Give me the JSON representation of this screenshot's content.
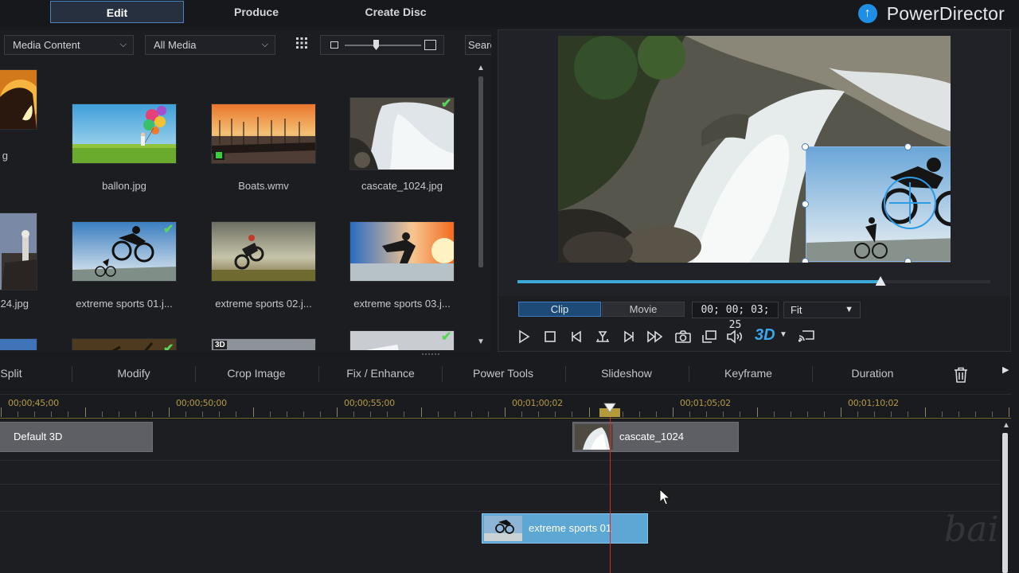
{
  "top_tabs": {
    "edit": "Edit",
    "produce": "Produce",
    "create_disc": "Create Disc"
  },
  "brand": {
    "name": "PowerDirector",
    "logo_glyph": "↑"
  },
  "library": {
    "content_dropdown": "Media Content",
    "filter_dropdown": "All Media",
    "search_placeholder": "Search",
    "items": [
      {
        "name": "g",
        "scene": "rock"
      },
      {
        "name": "ballon.jpg",
        "scene": "balloon"
      },
      {
        "name": "Boats.wmv",
        "scene": "boats",
        "video": true
      },
      {
        "name": "cascate_1024.jpg",
        "scene": "waterfall",
        "used": true
      },
      {
        "name": "24.jpg",
        "scene": "castle"
      },
      {
        "name": "extreme sports 01.j...",
        "scene": "bike",
        "used": true
      },
      {
        "name": "extreme sports 02.j...",
        "scene": "moto"
      },
      {
        "name": "extreme sports 03.j...",
        "scene": "sunset"
      },
      {
        "name": "",
        "scene": "sky"
      },
      {
        "name": "",
        "scene": "forest",
        "used": true
      },
      {
        "name": "",
        "scene": "motorbikes",
        "badge": "3D"
      },
      {
        "name": "",
        "scene": "music",
        "used": true
      }
    ]
  },
  "preview": {
    "mode_clip": "Clip",
    "mode_movie": "Movie",
    "timecode": "00; 00; 03; 25",
    "fit": "Fit",
    "progress": 0.767,
    "three_d_label": "3D"
  },
  "tools": [
    "Split",
    "Modify",
    "Crop Image",
    "Fix / Enhance",
    "Power Tools",
    "Slideshow",
    "Keyframe",
    "Duration"
  ],
  "ruler_labels": [
    "00;00;45;00",
    "00;00;50;00",
    "00;00;55;00",
    "00;01;00;02",
    "00;01;05;02",
    "00;01;10;02"
  ],
  "timeline": {
    "clip_default3d": "Default 3D",
    "clip_cascate": "cascate_1024",
    "clip_extreme": "extreme sports 01"
  },
  "colors": {
    "accent": "#3da9d8",
    "playhead": "#e0262c",
    "selected_clip": "#5da7d4",
    "check": "#57d65a"
  },
  "watermark": "bai"
}
